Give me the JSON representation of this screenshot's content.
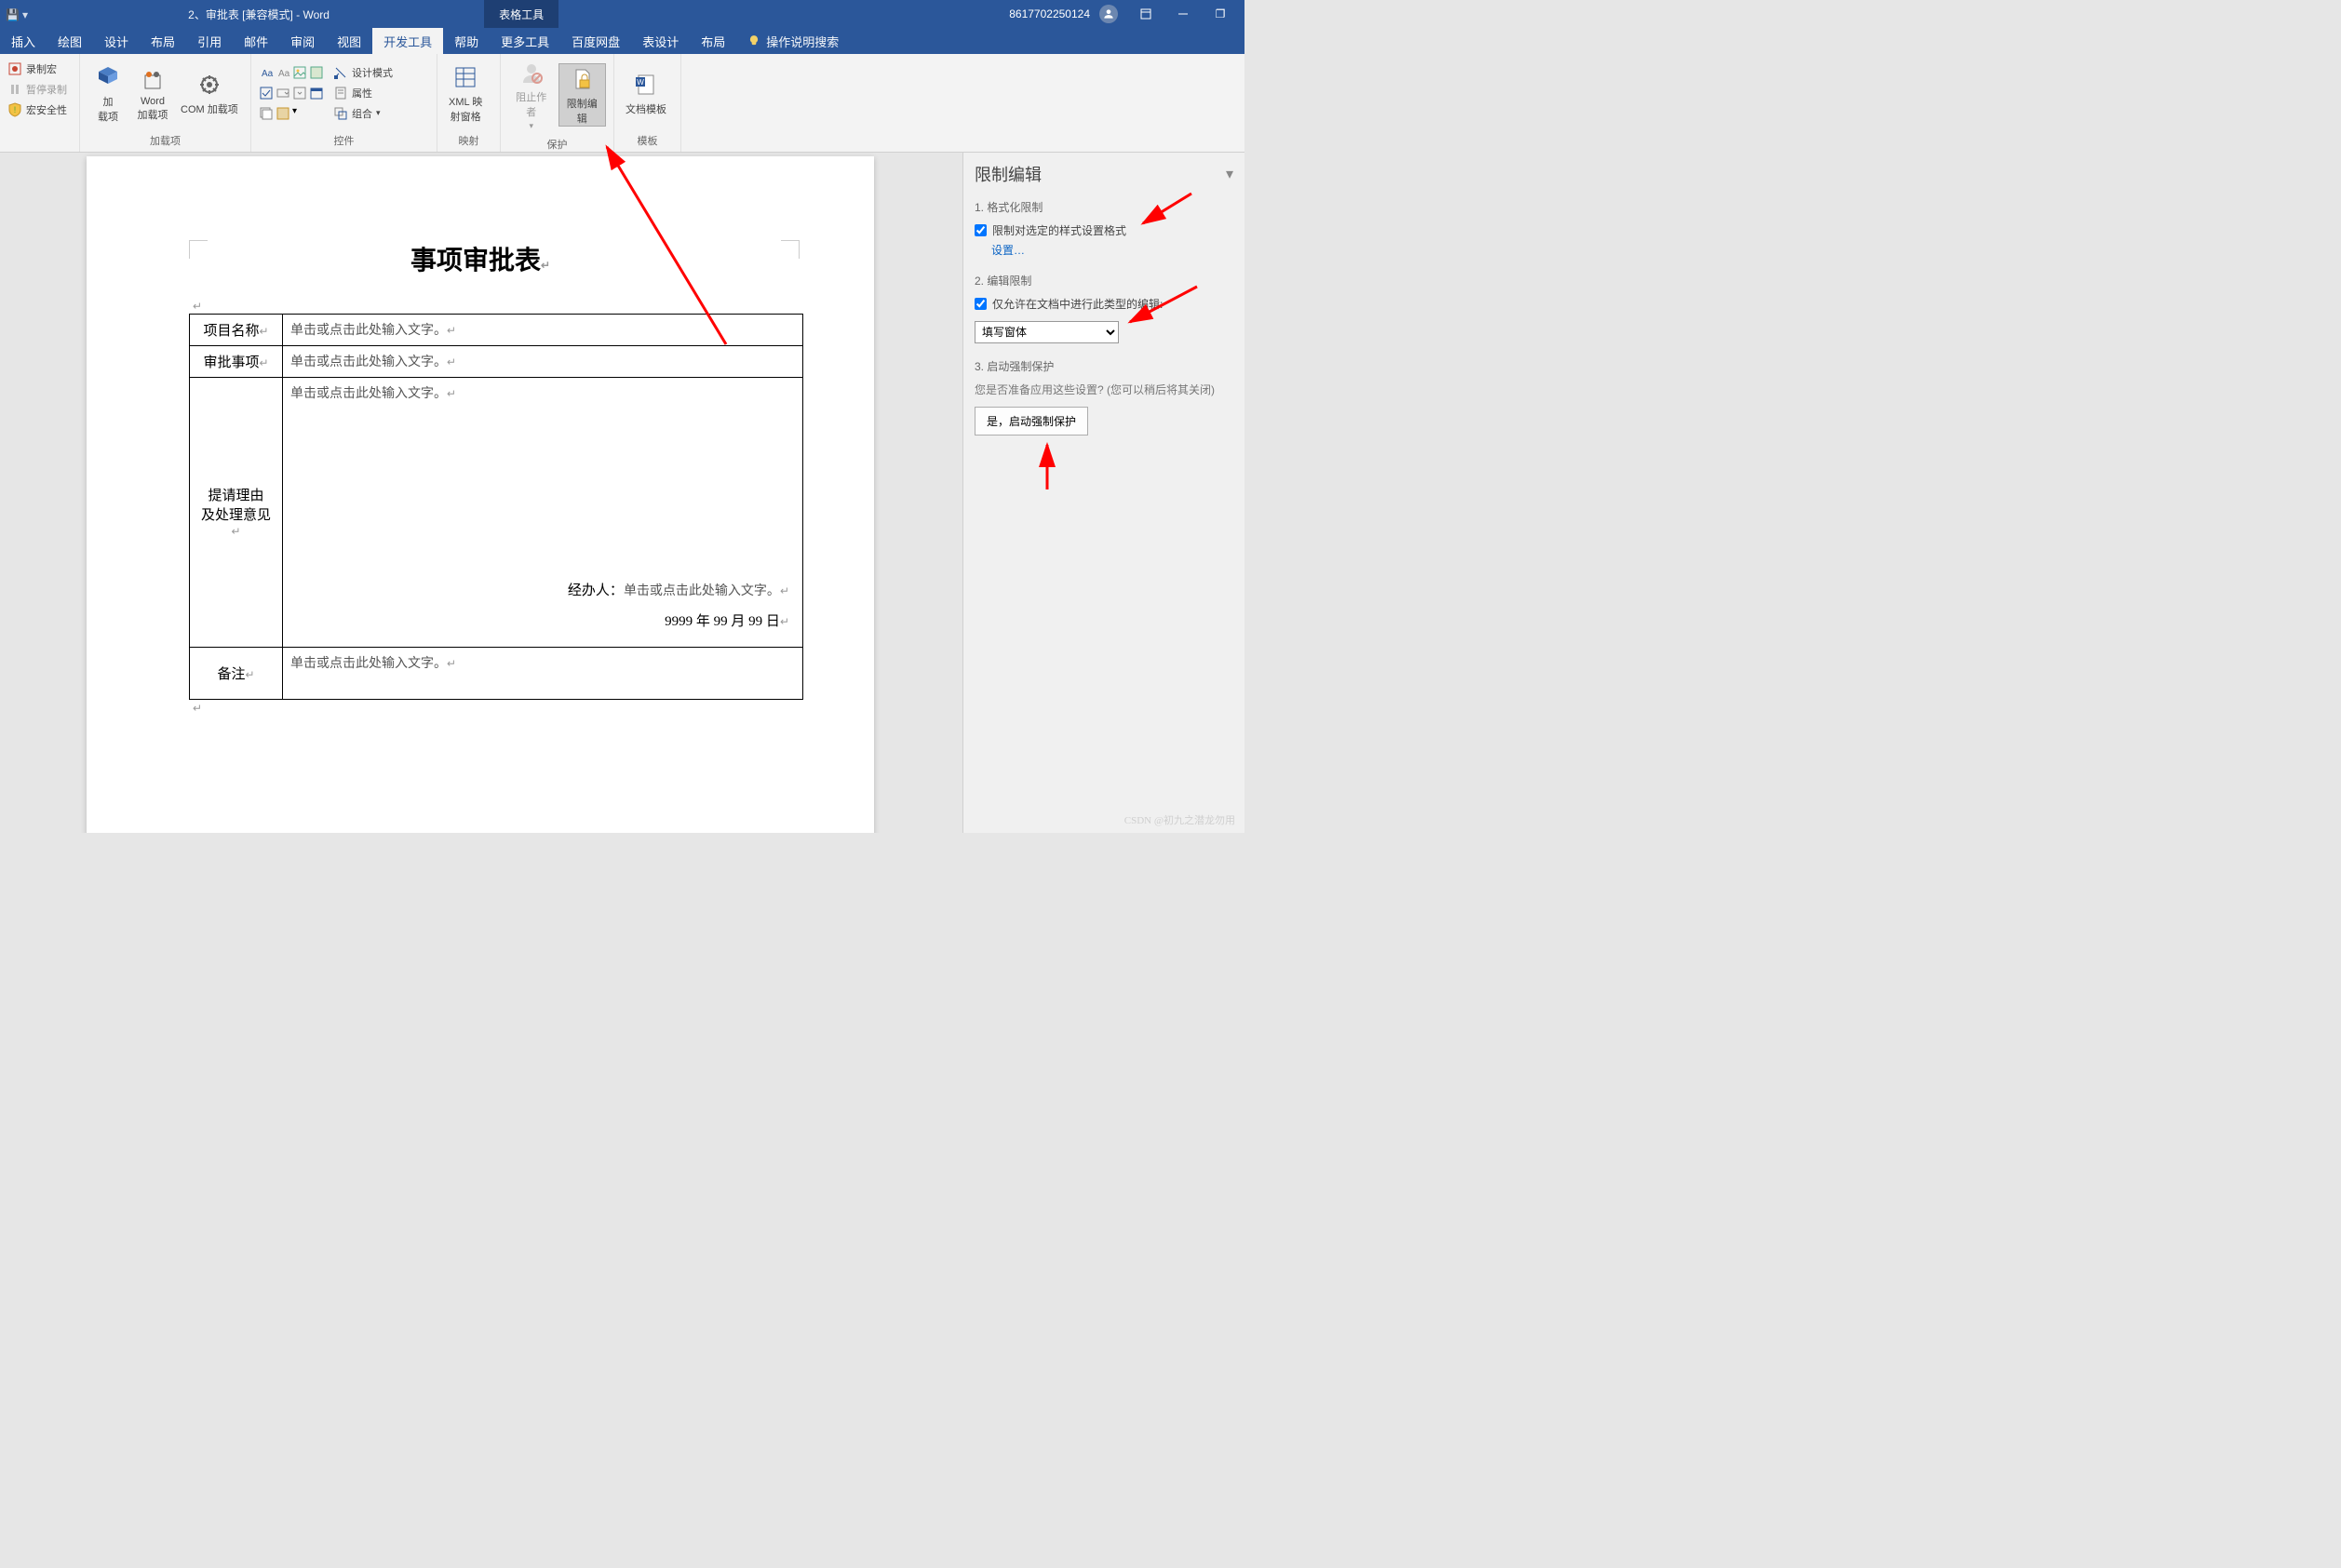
{
  "titlebar": {
    "doc_title": "2、审批表 [兼容模式] - Word",
    "tool_tab": "表格工具",
    "account": "8617702250124",
    "restore_box": "❐"
  },
  "tabs": {
    "insert": "插入",
    "draw": "绘图",
    "design": "设计",
    "layout1": "布局",
    "references": "引用",
    "mailings": "邮件",
    "review": "审阅",
    "view": "视图",
    "developer": "开发工具",
    "help": "帮助",
    "moretools": "更多工具",
    "baidu": "百度网盘",
    "tabledesign": "表设计",
    "layout2": "布局",
    "search_prompt": "操作说明搜索"
  },
  "ribbon": {
    "macros": {
      "record": "录制宏",
      "pause": "暂停录制",
      "security": "宏安全性"
    },
    "addins": {
      "addin": "加\n载项",
      "word_addin": "Word\n加载项",
      "com_addin": "COM 加载项",
      "group": "加载项"
    },
    "controls": {
      "designmode": "设计模式",
      "properties": "属性",
      "group_btn": "组合",
      "group": "控件"
    },
    "mapping": {
      "btn": "XML 映\n射窗格",
      "group": "映射"
    },
    "protect": {
      "block": "阻止作者",
      "restrict": "限制编辑",
      "group": "保护"
    },
    "template": {
      "btn": "文档模板",
      "group": "模板"
    }
  },
  "document": {
    "title": "事项审批表",
    "pmark": "↵",
    "row1_label": "项目名称",
    "row2_label": "审批事项",
    "row3_label_1": "提请理由",
    "row3_label_2": "及处理意见",
    "row4_label": "备注",
    "placeholder": "单击或点击此处输入文字。",
    "handler_label": "经办人：",
    "date": "9999 年 99 月 99 日"
  },
  "sidepane": {
    "title": "限制编辑",
    "sec1_title": "1. 格式化限制",
    "sec1_checkbox": "限制对选定的样式设置格式",
    "sec1_link": "设置…",
    "sec2_title": "2. 编辑限制",
    "sec2_checkbox": "仅允许在文档中进行此类型的编辑:",
    "sec2_select": "填写窗体",
    "sec3_title": "3. 启动强制保护",
    "sec3_desc": "您是否准备应用这些设置? (您可以稍后将其关闭)",
    "sec3_button": "是，启动强制保护"
  },
  "watermark": "CSDN @初九之潜龙勿用"
}
